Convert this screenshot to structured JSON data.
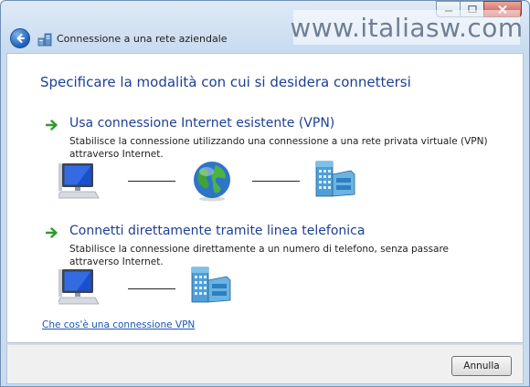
{
  "window": {
    "title": "Connessione a una rete aziendale",
    "watermark": "www.italiasw.com"
  },
  "main": {
    "heading": "Specificare la modalità con cui si desidera connettersi",
    "options": [
      {
        "title": "Usa connessione Internet esistente (VPN)",
        "description": "Stabilisce la connessione utilizzando una connessione a una rete privata virtuale (VPN) attraverso Internet."
      },
      {
        "title": "Connetti direttamente tramite linea telefonica",
        "description": "Stabilisce la connessione direttamente a un numero di telefono, senza passare attraverso Internet."
      }
    ],
    "help_link": "Che cos'è una connessione VPN"
  },
  "footer": {
    "cancel_label": "Annulla"
  },
  "colors": {
    "heading": "#1c3f95",
    "link": "#1a55b7",
    "arrow": "#2e9b2e"
  }
}
